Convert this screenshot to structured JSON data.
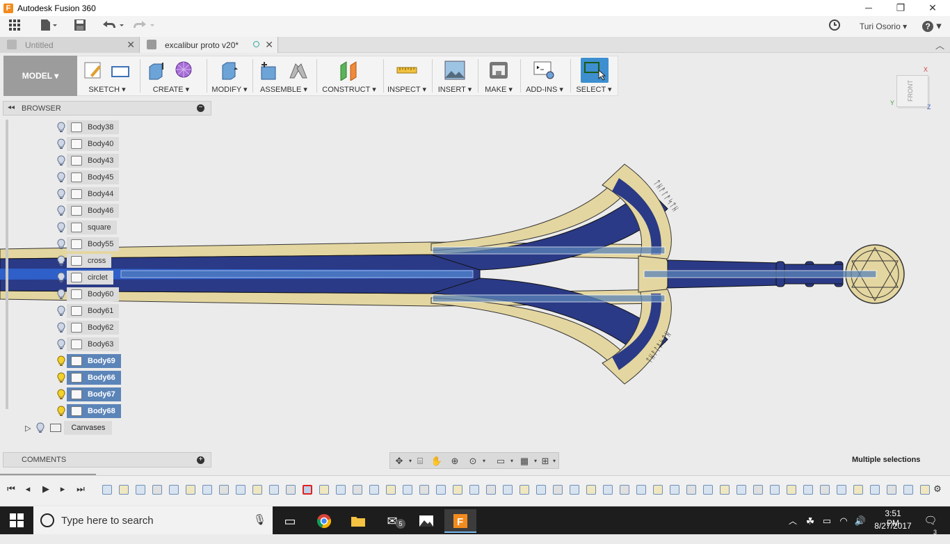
{
  "window": {
    "app_icon": "F",
    "title": "Autodesk Fusion 360",
    "minimize": "─",
    "restore": "❐",
    "close": "✕"
  },
  "qat": {
    "user": "Turi Osorio",
    "help": "?"
  },
  "tabs": [
    {
      "label": "Untitled"
    },
    {
      "label": "excalibur proto v20*"
    }
  ],
  "ribbon": {
    "workspace": "MODEL ▾",
    "groups": [
      {
        "label": "SKETCH ▾"
      },
      {
        "label": "CREATE ▾"
      },
      {
        "label": "MODIFY ▾"
      },
      {
        "label": "ASSEMBLE ▾"
      },
      {
        "label": "CONSTRUCT ▾"
      },
      {
        "label": "INSPECT ▾"
      },
      {
        "label": "INSERT ▾"
      },
      {
        "label": "MAKE ▾"
      },
      {
        "label": "ADD-INS ▾"
      },
      {
        "label": "SELECT ▾"
      }
    ]
  },
  "viewcube": {
    "label": "FRONT"
  },
  "browser": {
    "title": "BROWSER",
    "items": [
      {
        "label": "Body38",
        "selected": false
      },
      {
        "label": "Body40",
        "selected": false
      },
      {
        "label": "Body43",
        "selected": false
      },
      {
        "label": "Body45",
        "selected": false
      },
      {
        "label": "Body44",
        "selected": false
      },
      {
        "label": "Body46",
        "selected": false
      },
      {
        "label": "square",
        "selected": false
      },
      {
        "label": "Body55",
        "selected": false
      },
      {
        "label": "cross",
        "selected": false
      },
      {
        "label": "circlet",
        "selected": false
      },
      {
        "label": "Body60",
        "selected": false
      },
      {
        "label": "Body61",
        "selected": false
      },
      {
        "label": "Body62",
        "selected": false
      },
      {
        "label": "Body63",
        "selected": false
      },
      {
        "label": "Body69",
        "selected": true
      },
      {
        "label": "Body66",
        "selected": true
      },
      {
        "label": "Body67",
        "selected": true
      },
      {
        "label": "Body68",
        "selected": true
      }
    ],
    "canvases": "Canvases"
  },
  "comments": {
    "title": "COMMENTS"
  },
  "status": {
    "text": "Multiple selections"
  },
  "taskbar": {
    "search_placeholder": "Type here to search",
    "mail_badge": "5",
    "time": "3:51 PM",
    "date": "8/27/2017",
    "notifications": "3"
  },
  "colors": {
    "selection": "#5b84b8",
    "blade": "#e4d6a0",
    "blade_blue": "#2a3a86",
    "ribbon_select": "#3d8fd0"
  }
}
